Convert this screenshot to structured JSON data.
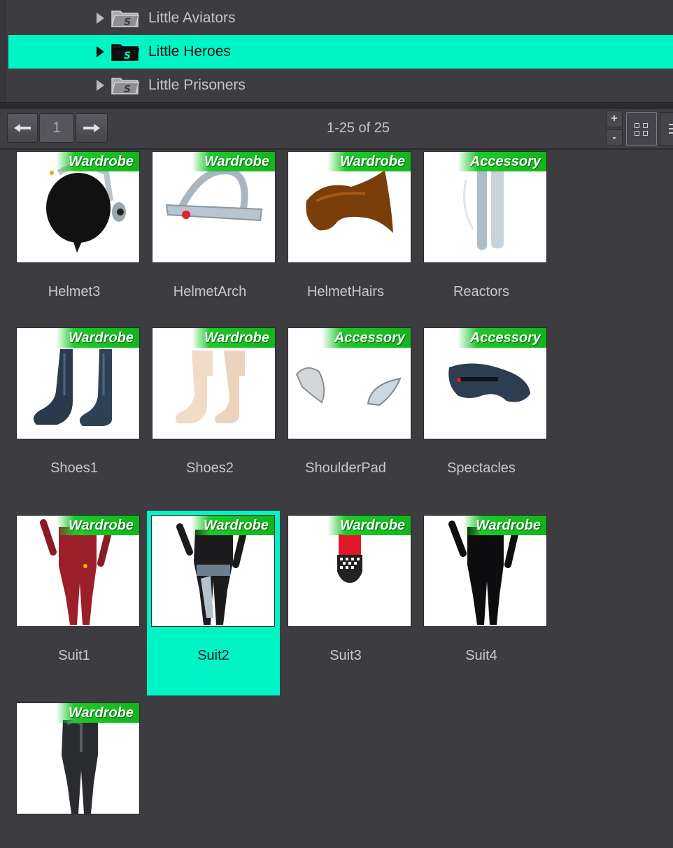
{
  "tree": {
    "items": [
      {
        "label": "Little Aviators",
        "selected": false
      },
      {
        "label": "Little Heroes",
        "selected": true
      },
      {
        "label": "Little Prisoners",
        "selected": false
      }
    ]
  },
  "pager": {
    "current_page": "1",
    "count_text": "1-25 of 25"
  },
  "toolbar": {
    "zoom_in": "+",
    "zoom_out": "-"
  },
  "tiles": [
    {
      "label": "Helmet3",
      "badge": "Wardrobe",
      "icon": "helmet-icon"
    },
    {
      "label": "HelmetArch",
      "badge": "Wardrobe",
      "icon": "helmet-arch-icon"
    },
    {
      "label": "HelmetHairs",
      "badge": "Wardrobe",
      "icon": "hair-icon"
    },
    {
      "label": "Reactors",
      "badge": "Accessory",
      "icon": "reactor-icon"
    },
    {
      "label": "Shoes1",
      "badge": "Wardrobe",
      "icon": "boots-icon"
    },
    {
      "label": "Shoes2",
      "badge": "Wardrobe",
      "icon": "boots-icon"
    },
    {
      "label": "ShoulderPad",
      "badge": "Accessory",
      "icon": "shoulder-pad-icon"
    },
    {
      "label": "Spectacles",
      "badge": "Accessory",
      "icon": "visor-icon"
    },
    {
      "label": "Suit1",
      "badge": "Wardrobe",
      "icon": "suit-icon"
    },
    {
      "label": "Suit2",
      "badge": "Wardrobe",
      "icon": "suit-icon",
      "selected": true
    },
    {
      "label": "Suit3",
      "badge": "Wardrobe",
      "icon": "suit-icon"
    },
    {
      "label": "Suit4",
      "badge": "Wardrobe",
      "icon": "suit-icon"
    },
    {
      "label": "",
      "badge": "Wardrobe",
      "icon": "suit-icon"
    }
  ],
  "colors": {
    "selection": "#00f5c6",
    "badge_green": "#1fc92a",
    "panel_bg": "#3d3c41"
  }
}
